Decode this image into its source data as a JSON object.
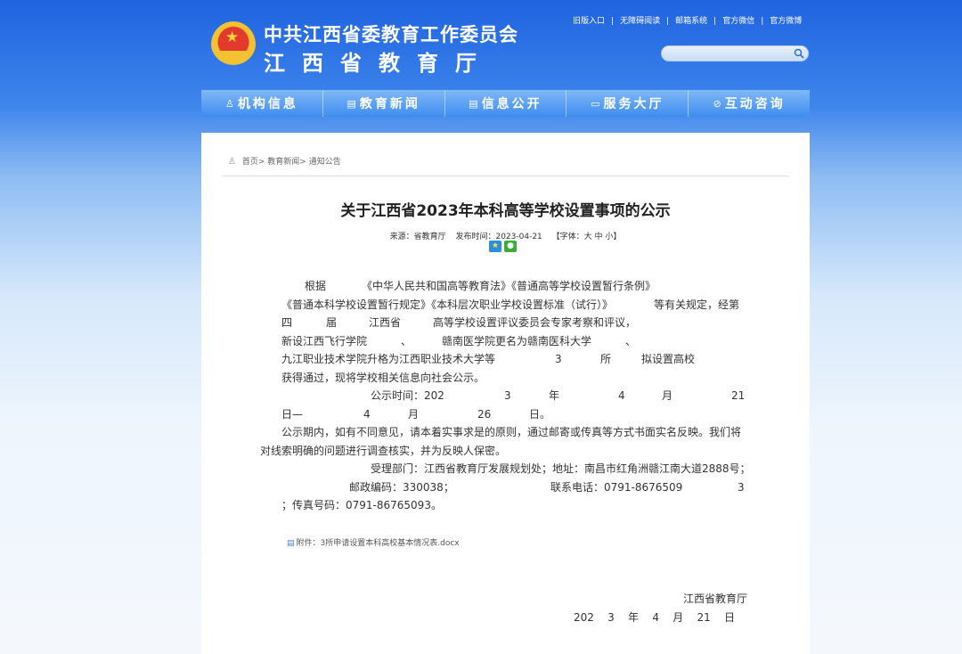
{
  "header": {
    "org_name": "中共江西省委教育工作委员会",
    "dept_name": "江西省教育厅",
    "top_links": [
      "旧版入口",
      "无障碍阅读",
      "邮箱系统",
      "官方微信",
      "官方微博"
    ],
    "search_placeholder": ""
  },
  "nav": [
    {
      "icon": "♙",
      "label": "机构信息"
    },
    {
      "icon": "▤",
      "label": "教育新闻"
    },
    {
      "icon": "▤",
      "label": "信息公开"
    },
    {
      "icon": "▭",
      "label": "服务大厅"
    },
    {
      "icon": "⊘",
      "label": "互动咨询"
    }
  ],
  "breadcrumb": {
    "items": [
      "首页>",
      "教育新闻>",
      "通知公告"
    ]
  },
  "article": {
    "title": "关于江西省2023年本科高等学校设置事项的公示",
    "source": "来源：省教育厅",
    "publish_time": "发布时间：2023-04-21",
    "font_size_label": "【字体：大 中 小】",
    "lines": [
      "根据",
      "《中华人民共和国高等教育法》《普通高等学校设置暂行条例》",
      "《普通本科学校设置暂行规定》《本科层次职业学校设置标准（试行）》",
      "等有关规定，经第",
      "四",
      "届",
      "江西省",
      "高等学校设置评议委员会专家考察和评议，",
      "新设江西飞行学院",
      "、",
      "赣南医学院更名为赣南医科大学",
      "、",
      "九江职业技术学院升格为江西职业技术大学等",
      "3",
      "所",
      "拟设置高校",
      "获得通过，现将学校相关信息向社会公示。",
      "公示时间：202",
      "3",
      "年",
      "4",
      "月",
      "21",
      "日—",
      "4",
      "月",
      "26",
      "日。",
      "公示期内，如有不同意见，请本着实事求是的原则，通过邮寄或传真等方式书面实名反映。我们将",
      "对线索明确的问题进行调查核实，并为反映人保密。",
      "受理部门：江西省教育厅发展规划处；地址：南昌市红角洲赣江南大道2888号；",
      "邮政编码：330038；",
      "联系电话：0791-8676509",
      "3",
      "；传真号码：0791-86765093。"
    ],
    "attachment": "附件：3所申请设置本科高校基本情况表.docx",
    "sign_org": "江西省教育厅",
    "sign_date": "202    3    年    4    月    21    日"
  }
}
